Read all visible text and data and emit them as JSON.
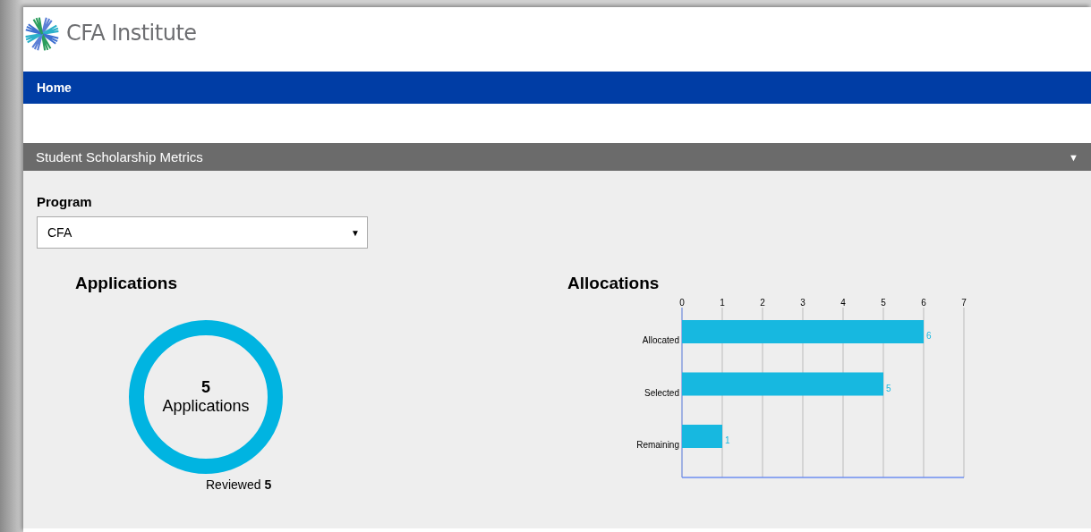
{
  "header": {
    "logo_text": "CFA Institute"
  },
  "nav": {
    "items": [
      {
        "label": "Home"
      }
    ]
  },
  "panel": {
    "title": "Student Scholarship Metrics",
    "toggle": "▼"
  },
  "program": {
    "label": "Program",
    "value": "CFA",
    "caret": "▼"
  },
  "applications": {
    "title": "Applications",
    "count": "5",
    "count_label": "Applications",
    "reviewed": "Reviewed **5**"
  },
  "allocations": {
    "title": "Allocations",
    "chart_data": {
      "type": "bar",
      "orientation": "horizontal",
      "categories": [
        "Allocated",
        "Selected",
        "Remaining"
      ],
      "series": [
        {
          "color": "#17b8e0",
          "values": [
            6,
            5,
            1
          ]
        }
      ],
      "xlim": [
        0,
        7
      ],
      "xticks": [
        0,
        1,
        2,
        3,
        4,
        5,
        6,
        7
      ],
      "grid": true,
      "data_labels": true
    }
  }
}
